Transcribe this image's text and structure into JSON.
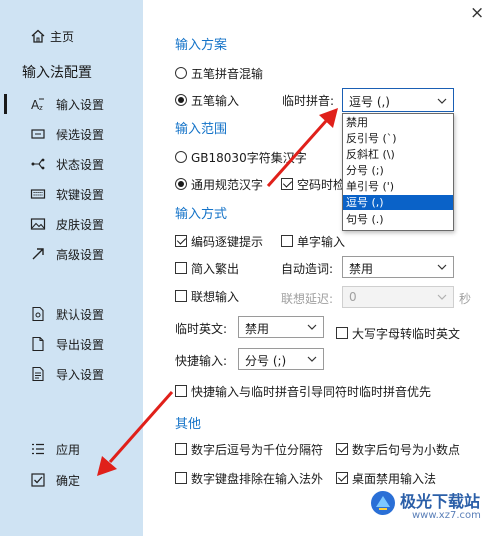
{
  "sidebar": {
    "home": "主页",
    "title": "输入法配置",
    "items": [
      "输入设置",
      "候选设置",
      "状态设置",
      "软键设置",
      "皮肤设置",
      "高级设置"
    ],
    "lower_items": [
      "默认设置",
      "导出设置",
      "导入设置"
    ],
    "apply": "应用",
    "ok": "确定"
  },
  "window": {
    "close": "×"
  },
  "scheme": {
    "header": "输入方案",
    "opt_mixed": "五笔拼音混输",
    "opt_wubi": "五笔输入",
    "temp_pinyin_label": "临时拼音:",
    "temp_pinyin_value": "逗号 (,)",
    "dropdown_options": [
      "禁用",
      "反引号 (`)",
      "反斜杠 (\\)",
      "分号 (;)",
      "单引号 (')",
      "逗号 (,)",
      "句号 (.)"
    ]
  },
  "range": {
    "header": "输入范围",
    "opt_gb": "GB18030字符集汉字",
    "opt_std": "通用规范汉字",
    "chk_space": "空码时检"
  },
  "method": {
    "header": "输入方式",
    "chk_hint": "编码逐键提示",
    "chk_single": "单字输入",
    "chk_simp": "简入繁出",
    "auto_word_label": "自动造词:",
    "auto_word_value": "禁用",
    "chk_assoc": "联想输入",
    "assoc_delay_label": "联想延迟:",
    "assoc_delay_value": "0",
    "seconds": "秒",
    "temp_en_label": "临时英文:",
    "temp_en_value": "禁用",
    "chk_caps": "大写字母转临时英文",
    "quick_label": "快捷输入:",
    "quick_value": "分号 (;)",
    "chk_quick_priority": "快捷输入与临时拼音引导同符时临时拼音优先"
  },
  "other": {
    "header": "其他",
    "chk_comma": "数字后逗号为千位分隔符",
    "chk_period": "数字后句号为小数点",
    "chk_keypad": "数字键盘排除在输入法外",
    "chk_desktop": "桌面禁用输入法"
  },
  "watermark": {
    "name": "极光下载站",
    "url": "www.xz7.com"
  },
  "colors": {
    "sidebar_bg": "#cfe3f3",
    "accent": "#1473c8",
    "selection": "#0a62c8",
    "annotation_arrow": "#e0201a"
  }
}
